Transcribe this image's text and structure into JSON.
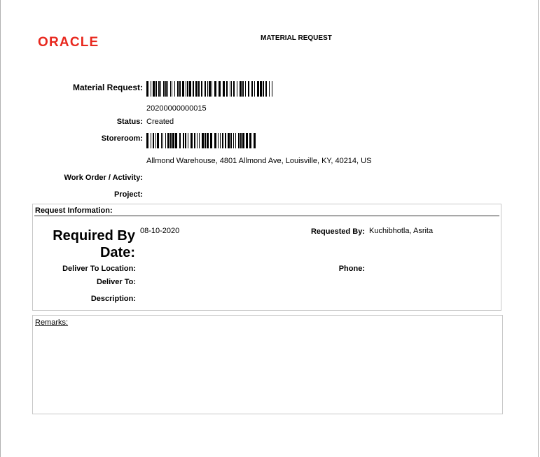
{
  "header": {
    "logo_text": "ORACLE",
    "title": "MATERIAL REQUEST"
  },
  "fields": {
    "material_request_label": "Material Request:",
    "material_request_number": "20200000000015",
    "status_label": "Status:",
    "status_value": "Created",
    "storeroom_label": "Storeroom:",
    "storeroom_address": "Allmond Warehouse, 4801 Allmond Ave, Louisville, KY, 40214, US",
    "work_order_label": "Work Order / Activity:",
    "project_label": "Project:"
  },
  "request_info": {
    "title": "Request Information:",
    "required_by_label": "Required By Date:",
    "required_by_value": "08-10-2020",
    "requested_by_label": "Requested By:",
    "requested_by_value": "Kuchibhotla, Asrita",
    "deliver_to_location_label": "Deliver To Location:",
    "phone_label": "Phone:",
    "deliver_to_label": "Deliver To:",
    "description_label": "Description:"
  },
  "remarks": {
    "title": "Remarks:"
  },
  "colors": {
    "brand": "#e8281e"
  }
}
